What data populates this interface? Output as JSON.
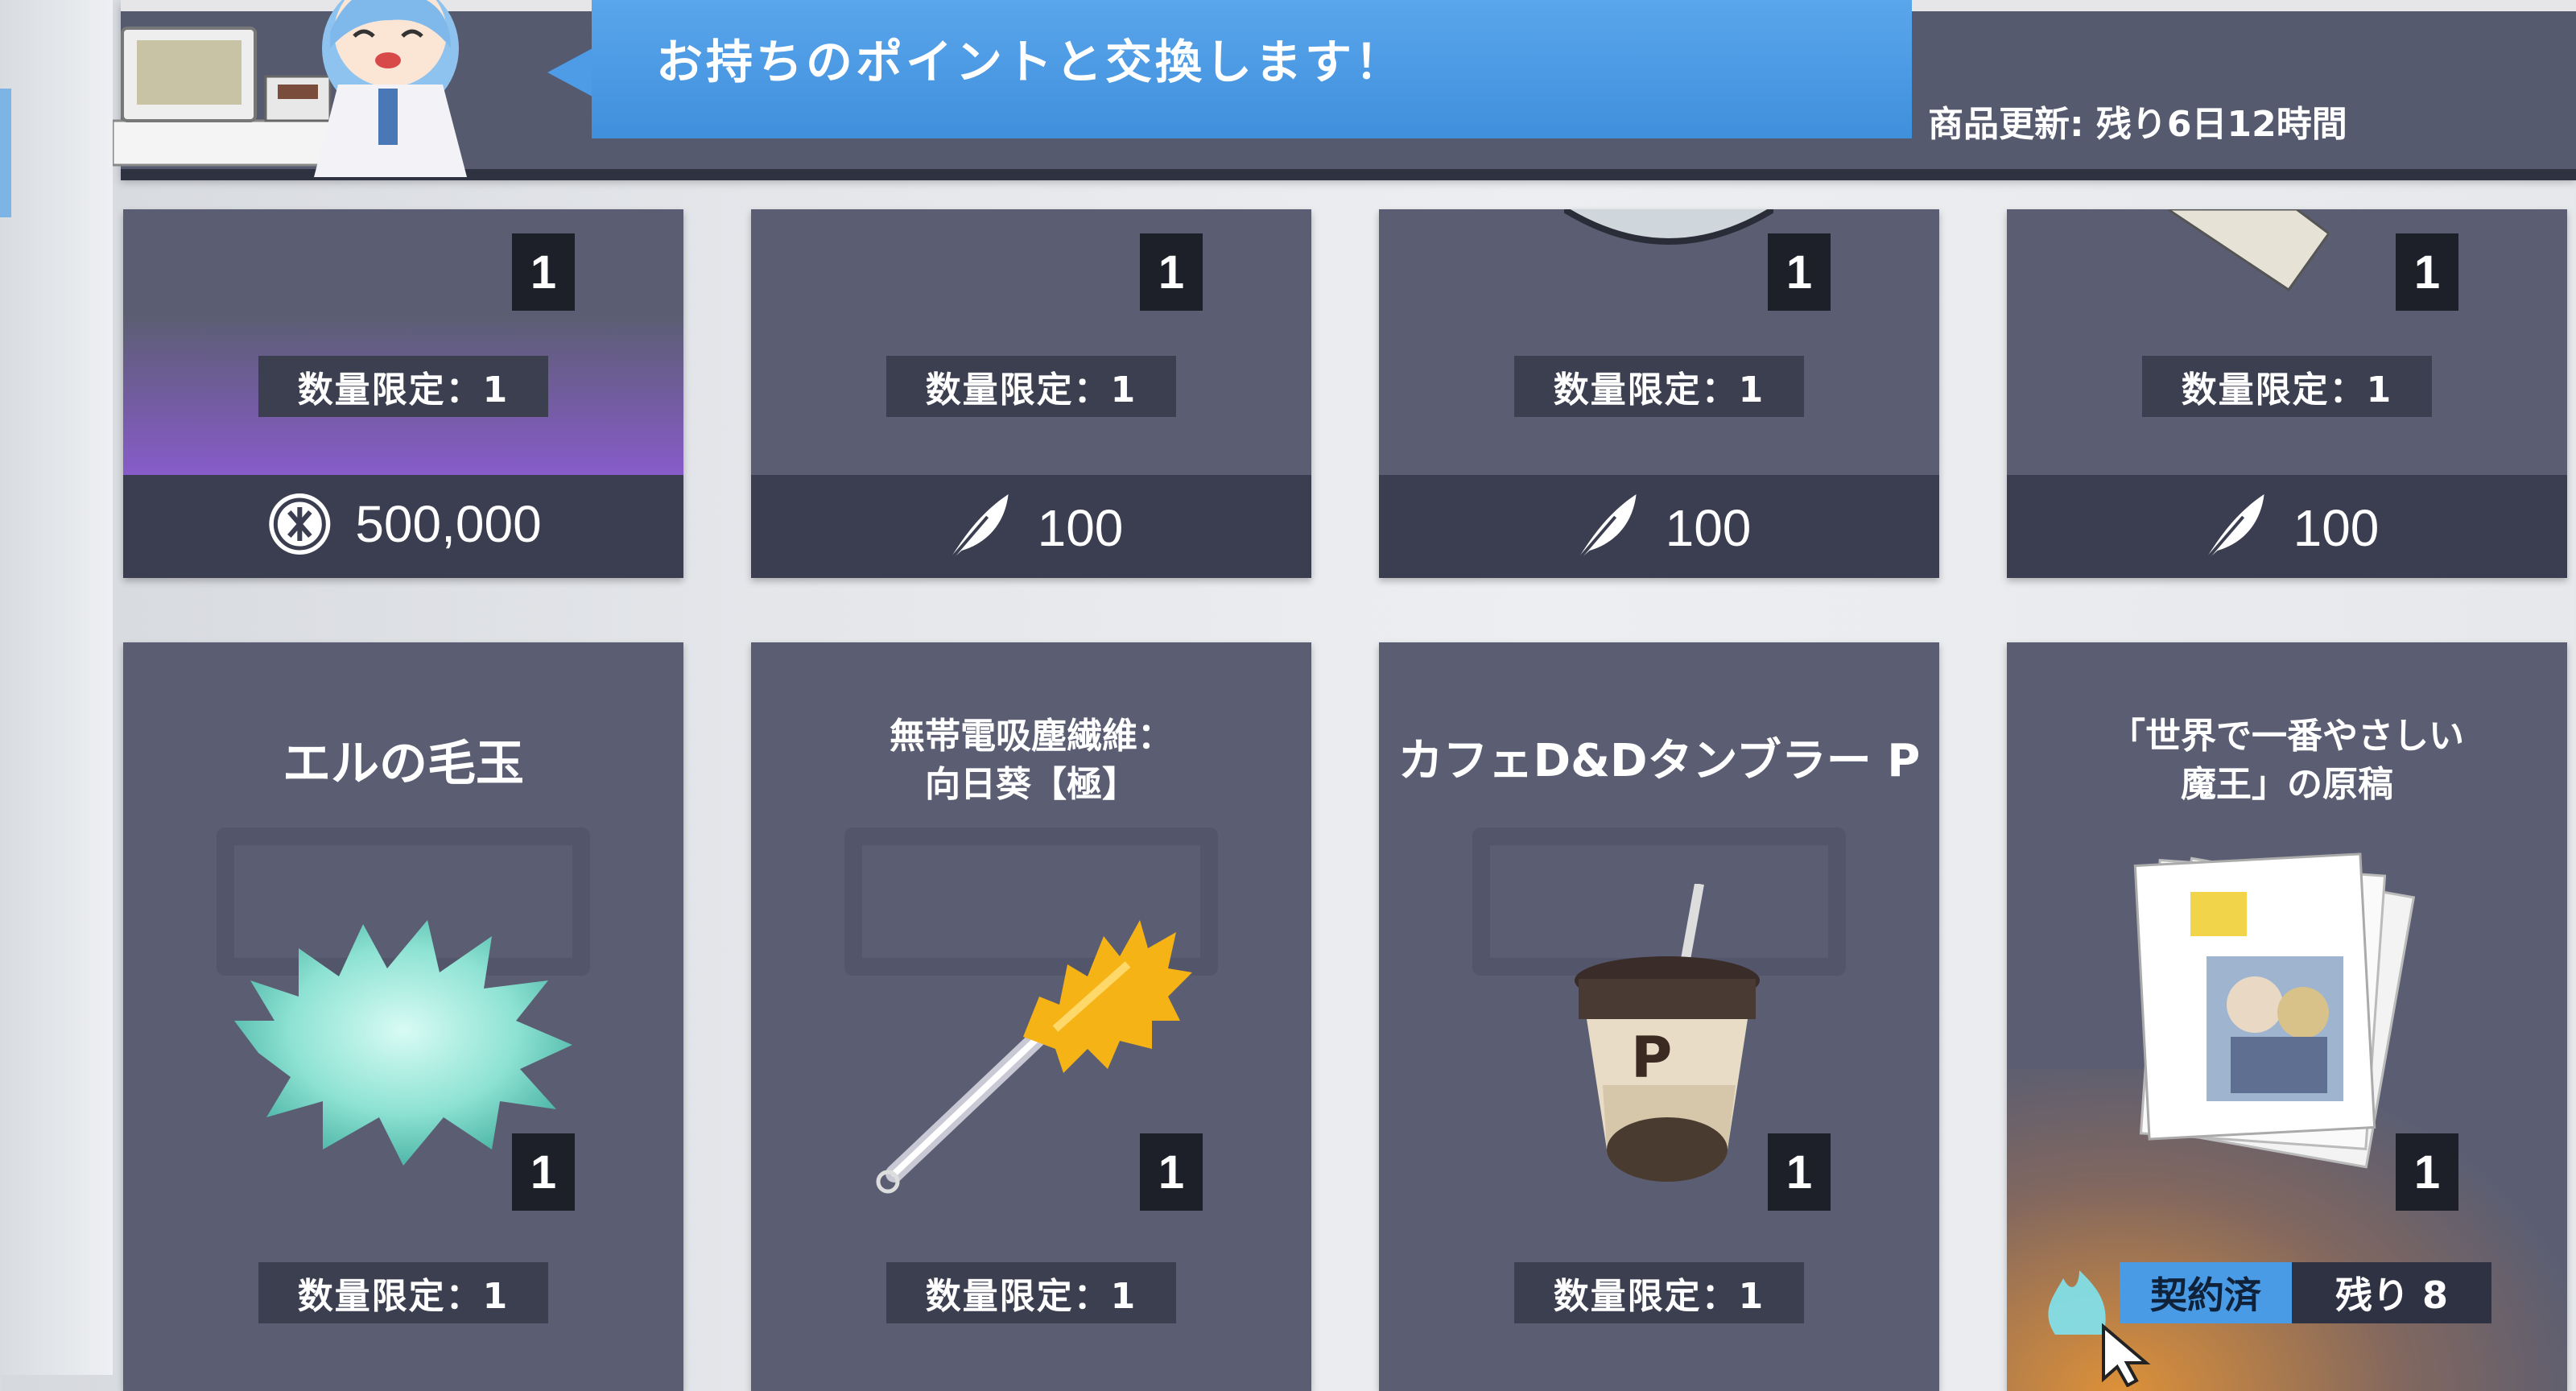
{
  "header": {
    "message": "お持ちのポイントと交換します！",
    "refresh": "商品更新: 残り6日12時間"
  },
  "top_row": [
    {
      "qty": "1",
      "limit": "数量限定：1",
      "price": "500,000",
      "currency_icon": "coin-icon"
    },
    {
      "qty": "1",
      "limit": "数量限定：1",
      "price": "100",
      "currency_icon": "feather-icon"
    },
    {
      "qty": "1",
      "limit": "数量限定：1",
      "price": "100",
      "currency_icon": "feather-icon"
    },
    {
      "qty": "1",
      "limit": "数量限定：1",
      "price": "100",
      "currency_icon": "feather-icon"
    }
  ],
  "bottom_row": [
    {
      "title": "エルの毛玉",
      "qty": "1",
      "limit": "数量限定：1"
    },
    {
      "title_line1": "無帯電吸塵繊維：",
      "title_line2": "向日葵【極】",
      "qty": "1",
      "limit": "数量限定：1"
    },
    {
      "title": "カフェD&Dタンブラー P",
      "qty": "1",
      "limit": "数量限定：1"
    },
    {
      "title_line1": "「世界で一番やさしい",
      "title_line2": "魔王」の原稿",
      "qty": "1",
      "contract_label": "契約済",
      "remaining": "残り 8"
    }
  ],
  "colors": {
    "card": "#5b5e72",
    "price_bar": "#3b3e50",
    "speech": "#4e9be6",
    "contract": "#4a9be6"
  }
}
